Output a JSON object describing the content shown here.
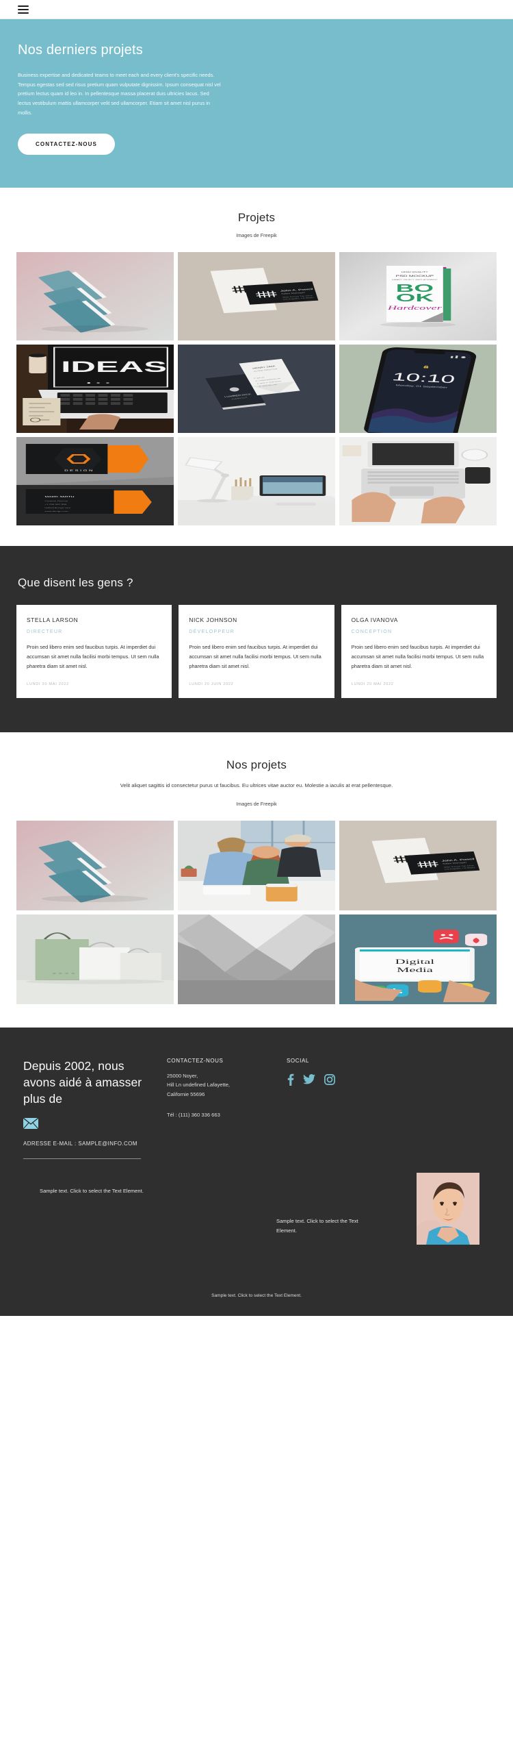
{
  "header": {
    "menu_icon": "hamburger-icon"
  },
  "hero": {
    "title": "Nos derniers projets",
    "paragraph": "Business expertise and dedicated teams to meet each and every client's specific needs. Tempus egestas sed sed risus pretium quam vulputate dignissim. Ipsum consequat nisl vel pretium lectus quam id leo in. In pellentesque massa placerat duis ultricies lacus. Sed lectus vestibulum mattis ullamcorper velit sed ullamcorper. Etiam sit amet nisl purus in mollis.",
    "cta_label": "CONTACTEZ-NOUS",
    "bg_color": "#78bdcb"
  },
  "projects_section": {
    "title": "Projets",
    "credit": "Images de Freepik"
  },
  "testimonials_section": {
    "title": "Que disent les gens ?",
    "bg_color": "#2f2f2f",
    "items": [
      {
        "name": "STELLA LARSON",
        "role": "DIRECTEUR",
        "text": "Proin sed libero enim sed faucibus turpis. At imperdiet dui accumsan sit amet nulla facilisi morbi tempus. Ut sem nulla pharetra diam sit amet nisl.",
        "date": "LUNDI 20 MAI 2022"
      },
      {
        "name": "NICK JOHNSON",
        "role": "DÉVELOPPEUR",
        "text": "Proin sed libero enim sed faucibus turpis. At imperdiet dui accumsan sit amet nulla facilisi morbi tempus. Ut sem nulla pharetra diam sit amet nisl.",
        "date": "LUNDI 20 JUIN 2022"
      },
      {
        "name": "OLGA IVANOVA",
        "role": "CONCEPTION",
        "text": "Proin sed libero enim sed faucibus turpis. At imperdiet dui accumsan sit amet nulla facilisi morbi tempus. Ut sem nulla pharetra diam sit amet nisl.",
        "date": "LUNDI 20 MAI 2022"
      }
    ]
  },
  "projects2_section": {
    "title": "Nos projets",
    "lead": "Velit aliquet sagittis id consectetur purus ut faucibus. Eu ultrices vitae auctor eu. Molestie a iaculis at erat pellentesque.",
    "credit": "Images de Freepik"
  },
  "footer": {
    "heading": "Depuis 2002, nous avons aidé à amasser plus de",
    "mail_icon": "envelope-icon",
    "email_label": "ADRESSE E-MAIL : SAMPLE@INFO.COM",
    "contact_heading": "CONTACTEZ-NOUS",
    "address": "25000 Noyer,\nHill Ln undefined Lafayette,\nCalifornie 55696",
    "phone": "Tél :  (111) 360 336 663",
    "social_heading": "SOCIAL",
    "socials": [
      {
        "name": "facebook-icon",
        "glyph": "f"
      },
      {
        "name": "twitter-icon",
        "glyph": "t"
      },
      {
        "name": "instagram-icon",
        "glyph": "i"
      }
    ],
    "sample_left": "Sample text. Click to select the Text Element.",
    "sample_right": "Sample text. Click to select the Text Element.",
    "sample_bottom": "Sample text. Click to select the Text Element.",
    "avatar_alt": "portrait-photo",
    "accent_color": "#78bdcb"
  },
  "gallery1": [
    {
      "name": "book-covers-mockup",
      "alt": "Stacked teal book covers mockup"
    },
    {
      "name": "business-cards-dark",
      "alt": "Black and white business cards"
    },
    {
      "name": "book-hardcover-mockup",
      "alt": "BOOK Hardcover PSD mockup"
    },
    {
      "name": "laptop-ideas-desk",
      "alt": "Laptop showing IDEAS on desk"
    },
    {
      "name": "business-cards-navy",
      "alt": "Business cards on navy background"
    },
    {
      "name": "smartphone-lockscreen",
      "alt": "Smartphone showing 10:10 lock screen"
    },
    {
      "name": "branding-orange-cards",
      "alt": "Orange and black design brand cards"
    },
    {
      "name": "desk-lamp-workspace",
      "alt": "White lamp and laptop workspace"
    },
    {
      "name": "hands-laptop-topview",
      "alt": "Top view hands typing on laptop"
    }
  ],
  "gallery2": [
    {
      "name": "book-covers-mockup-2",
      "alt": "Stacked teal book covers mockup"
    },
    {
      "name": "team-office-meeting",
      "alt": "Three colleagues working at a desk"
    },
    {
      "name": "business-cards-dark-2",
      "alt": "Black and white business cards"
    },
    {
      "name": "paper-shopping-bags",
      "alt": "Green and white paper shopping bags"
    },
    {
      "name": "folded-paper-abstract",
      "alt": "Abstract folded grey paper"
    },
    {
      "name": "digital-media-tablet",
      "alt": "Tablet showing Digital Media app icons"
    }
  ]
}
